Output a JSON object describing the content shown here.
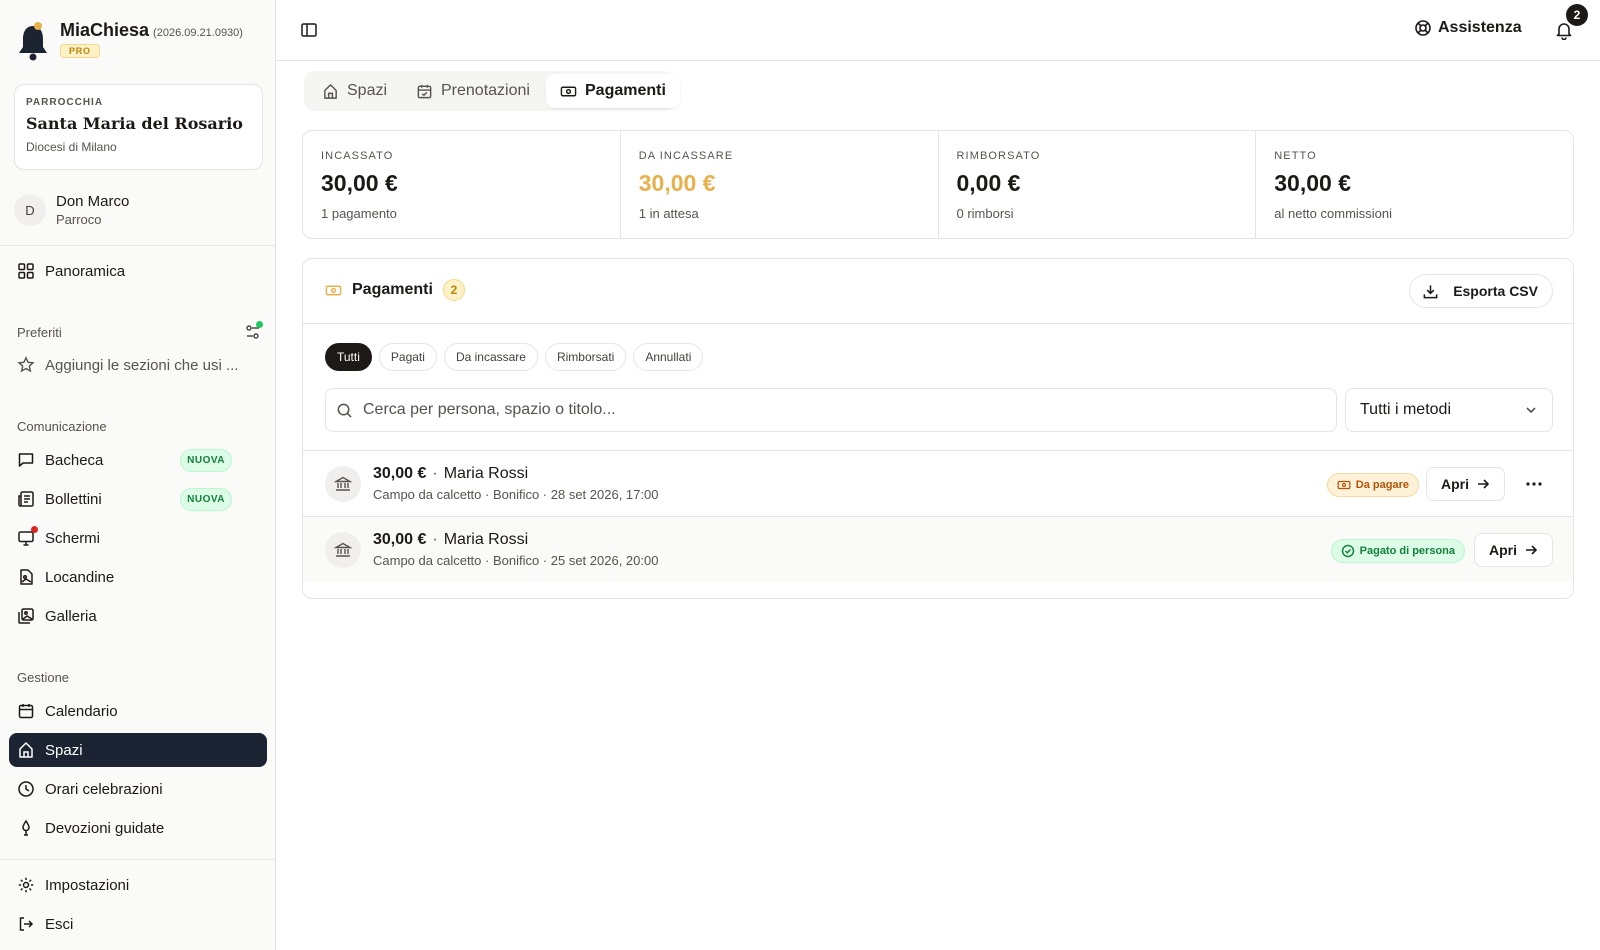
{
  "app": {
    "name": "MiaChiesa",
    "version": "(2026.09.21.0930)",
    "plan_badge": "PRO"
  },
  "parish": {
    "label": "PARROCCHIA",
    "name": "Santa Maria del Rosario",
    "diocese": "Diocesi di Milano"
  },
  "user": {
    "initial": "D",
    "name": "Don Marco",
    "role": "Parroco"
  },
  "sidebar": {
    "overview": "Panoramica",
    "favorites_label": "Preferiti",
    "favorites_hint": "Aggiungi le sezioni che usi ...",
    "communication_label": "Comunicazione",
    "communication_items": [
      {
        "label": "Bacheca",
        "badge": "NUOVA"
      },
      {
        "label": "Bollettini",
        "badge": "NUOVA"
      },
      {
        "label": "Schermi"
      },
      {
        "label": "Locandine"
      },
      {
        "label": "Galleria"
      }
    ],
    "management_label": "Gestione",
    "management_items": [
      {
        "label": "Calendario"
      },
      {
        "label": "Spazi"
      },
      {
        "label": "Orari celebrazioni"
      },
      {
        "label": "Devozioni guidate"
      }
    ],
    "settings": "Impostazioni",
    "logout": "Esci"
  },
  "topbar": {
    "help": "Assistenza",
    "notifications_count": "2"
  },
  "tabs": [
    {
      "label": "Spazi"
    },
    {
      "label": "Prenotazioni"
    },
    {
      "label": "Pagamenti"
    }
  ],
  "stats": [
    {
      "label": "INCASSATO",
      "value": "30,00 €",
      "sub": "1 pagamento"
    },
    {
      "label": "DA INCASSARE",
      "value": "30,00 €",
      "sub": "1 in attesa"
    },
    {
      "label": "RIMBORSATO",
      "value": "0,00 €",
      "sub": "0 rimborsi"
    },
    {
      "label": "NETTO",
      "value": "30,00 €",
      "sub": "al netto commissioni"
    }
  ],
  "payments": {
    "title": "Pagamenti",
    "count": "2",
    "export_label": "Esporta CSV",
    "filters": [
      "Tutti",
      "Pagati",
      "Da incassare",
      "Rimborsati",
      "Annullati"
    ],
    "search_placeholder": "Cerca per persona, spazio o titolo...",
    "method_select": "Tutti i metodi",
    "rows": [
      {
        "amount": "30,00 €",
        "person": "Maria Rossi",
        "details": "Campo da calcetto · Bonifico · 28 set 2026, 17:00",
        "status": "Da pagare",
        "action": "Apri"
      },
      {
        "amount": "30,00 €",
        "person": "Maria Rossi",
        "details": "Campo da calcetto · Bonifico · 25 set 2026, 20:00",
        "status": "Pagato di persona",
        "action": "Apri"
      }
    ]
  },
  "colors": {
    "active_nav": "#1c2333",
    "amber": "#e8b04b",
    "success": "#15803d",
    "danger": "#dc2626"
  }
}
